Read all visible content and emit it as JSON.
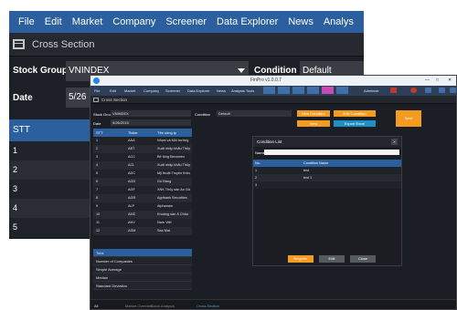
{
  "background_app": {
    "menu": [
      "File",
      "Edit",
      "Market",
      "Company",
      "Screener",
      "Data Explorer",
      "News",
      "Analys"
    ],
    "window_title": "Cross Section",
    "stock_group_label": "Stock Group",
    "stock_group_value": "VNINDEX",
    "condition_label": "Condition",
    "condition_value": "Default",
    "date_label": "Date",
    "date_value": "5/26",
    "table_header": "STT",
    "rows": [
      "1",
      "2",
      "3",
      "4",
      "5"
    ]
  },
  "finpro": {
    "title": "FinPro v1.0.0.7",
    "menu": [
      "File",
      "Edit",
      "Market",
      "Company",
      "Screener",
      "Data Explorer",
      "News",
      "Analysis Tools"
    ],
    "user_label": "Administr",
    "panel_title": "Cross Section",
    "stock_group_label": "Stock Group",
    "stock_group_value": "VNINDEX",
    "condition_label": "Condition",
    "condition_value": "Default",
    "date_label": "Date",
    "date_value": "5/26/2015",
    "buttons": {
      "new_condition": "New Condition",
      "edit_condition": "Edit Condition",
      "view": "View",
      "export_excel": "Export Excel",
      "side": "Save"
    },
    "table": {
      "headers": [
        "STT",
        "Ticker",
        "Tên công ty"
      ],
      "rows": [
        [
          "1",
          "AAA",
          "Nhựa và Môi trường"
        ],
        [
          "2",
          "ABT",
          "Xuất nhập khẩu Thủy sản"
        ],
        [
          "3",
          "ACC",
          "Bê tông Becamex"
        ],
        [
          "4",
          "ACL",
          "Xuất nhập khẩu Thủy sản"
        ],
        [
          "5",
          "ADC",
          "Mỹ thuật Truyền thông"
        ],
        [
          "6",
          "AGD",
          "Gò Đàng"
        ],
        [
          "7",
          "AGF",
          "XNK Thủy sản An Giang"
        ],
        [
          "8",
          "AGR",
          "Agribank Securities"
        ],
        [
          "9",
          "ALP",
          "Alphanam"
        ],
        [
          "10",
          "AMD",
          "Khoáng sản Á Châu"
        ],
        [
          "11",
          "ANV",
          "Nam Việt"
        ],
        [
          "12",
          "ASM",
          "Sao Mai"
        ]
      ]
    },
    "stats": [
      "Total",
      "Number of Companies",
      "Simple Average",
      "Median",
      "Standard Deviation"
    ],
    "bottom_tabs": [
      "All",
      "Market Overview",
      "Stock Analysis",
      "Cross Section"
    ]
  },
  "dialog": {
    "title": "Condition List",
    "name_label": "Name",
    "headers": [
      "No.",
      "Condition Name"
    ],
    "rows": [
      [
        "1",
        "test"
      ],
      [
        "2",
        "test 1"
      ],
      [
        "3",
        ""
      ]
    ],
    "buttons": [
      "Register",
      "Edit",
      "Close"
    ]
  },
  "colors": {
    "accent_blue": "#2b5f9e",
    "orange": "#f39c1f",
    "cyan": "#1e8fc4"
  }
}
